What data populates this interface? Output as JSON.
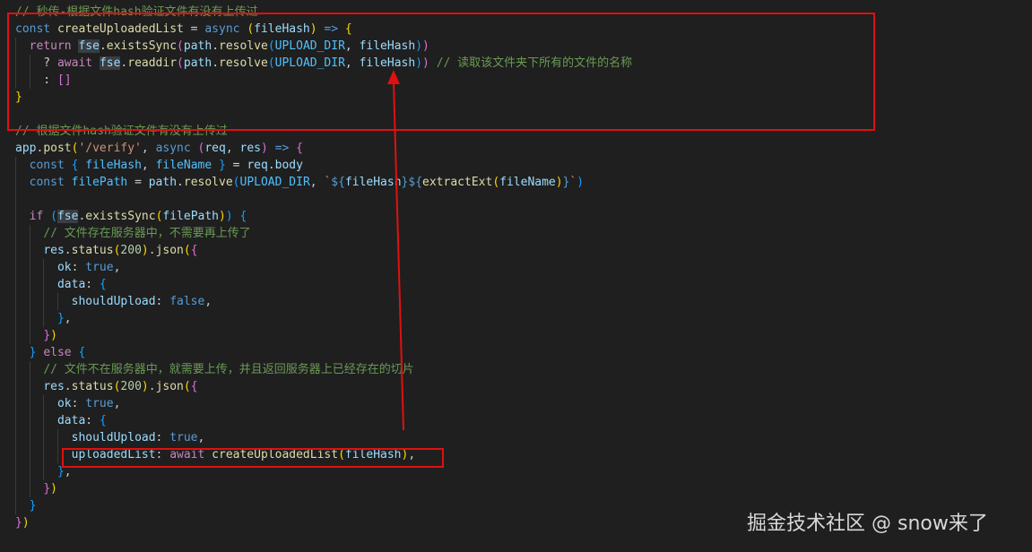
{
  "code": {
    "lines": [
      [
        {
          "t": "// 秒传-根据文件hash验证文件有没有上传过",
          "c": "comment"
        }
      ],
      [
        {
          "t": "const",
          "c": "kw"
        },
        {
          "t": " ",
          "c": "def"
        },
        {
          "t": "createUploadedList",
          "c": "fn"
        },
        {
          "t": " = ",
          "c": "def"
        },
        {
          "t": "async",
          "c": "kw"
        },
        {
          "t": " ",
          "c": "def"
        },
        {
          "t": "(",
          "c": "br1"
        },
        {
          "t": "fileHash",
          "c": "var"
        },
        {
          "t": ")",
          "c": "br1"
        },
        {
          "t": " ",
          "c": "def"
        },
        {
          "t": "=>",
          "c": "kw"
        },
        {
          "t": " ",
          "c": "def"
        },
        {
          "t": "{",
          "c": "br1"
        }
      ],
      [
        {
          "t": "  ",
          "c": "def"
        },
        {
          "t": "return",
          "c": "ctrl"
        },
        {
          "t": " ",
          "c": "def"
        },
        {
          "t": "fse",
          "c": "var",
          "hl": true
        },
        {
          "t": ".",
          "c": "def"
        },
        {
          "t": "existsSync",
          "c": "fn"
        },
        {
          "t": "(",
          "c": "br2"
        },
        {
          "t": "path",
          "c": "var"
        },
        {
          "t": ".",
          "c": "def"
        },
        {
          "t": "resolve",
          "c": "fn"
        },
        {
          "t": "(",
          "c": "br3"
        },
        {
          "t": "UPLOAD_DIR",
          "c": "const"
        },
        {
          "t": ", ",
          "c": "def"
        },
        {
          "t": "fileHash",
          "c": "var"
        },
        {
          "t": ")",
          "c": "br3"
        },
        {
          "t": ")",
          "c": "br2"
        }
      ],
      [
        {
          "t": "    ? ",
          "c": "def"
        },
        {
          "t": "await",
          "c": "ctrl"
        },
        {
          "t": " ",
          "c": "def"
        },
        {
          "t": "fse",
          "c": "var",
          "hl": true
        },
        {
          "t": ".",
          "c": "def"
        },
        {
          "t": "readdir",
          "c": "fn"
        },
        {
          "t": "(",
          "c": "br2"
        },
        {
          "t": "path",
          "c": "var"
        },
        {
          "t": ".",
          "c": "def"
        },
        {
          "t": "resolve",
          "c": "fn"
        },
        {
          "t": "(",
          "c": "br3"
        },
        {
          "t": "UPLOAD_DIR",
          "c": "const"
        },
        {
          "t": ", ",
          "c": "def"
        },
        {
          "t": "fileHash",
          "c": "var"
        },
        {
          "t": ")",
          "c": "br3"
        },
        {
          "t": ")",
          "c": "br2"
        },
        {
          "t": " ",
          "c": "def"
        },
        {
          "t": "// 读取该文件夹下所有的文件的名称",
          "c": "comment"
        }
      ],
      [
        {
          "t": "    : ",
          "c": "def"
        },
        {
          "t": "[]",
          "c": "br2"
        }
      ],
      [
        {
          "t": "}",
          "c": "br1"
        }
      ],
      [],
      [
        {
          "t": "// 根据文件hash验证文件有没有上传过",
          "c": "comment"
        }
      ],
      [
        {
          "t": "app",
          "c": "var"
        },
        {
          "t": ".",
          "c": "def"
        },
        {
          "t": "post",
          "c": "fn"
        },
        {
          "t": "(",
          "c": "br1"
        },
        {
          "t": "'/verify'",
          "c": "str"
        },
        {
          "t": ", ",
          "c": "def"
        },
        {
          "t": "async",
          "c": "kw"
        },
        {
          "t": " ",
          "c": "def"
        },
        {
          "t": "(",
          "c": "br2"
        },
        {
          "t": "req",
          "c": "var"
        },
        {
          "t": ", ",
          "c": "def"
        },
        {
          "t": "res",
          "c": "var"
        },
        {
          "t": ")",
          "c": "br2"
        },
        {
          "t": " ",
          "c": "def"
        },
        {
          "t": "=>",
          "c": "kw"
        },
        {
          "t": " ",
          "c": "def"
        },
        {
          "t": "{",
          "c": "br2"
        }
      ],
      [
        {
          "t": "  ",
          "c": "def"
        },
        {
          "t": "const",
          "c": "kw"
        },
        {
          "t": " ",
          "c": "def"
        },
        {
          "t": "{",
          "c": "br3"
        },
        {
          "t": " ",
          "c": "def"
        },
        {
          "t": "fileHash",
          "c": "const"
        },
        {
          "t": ", ",
          "c": "def"
        },
        {
          "t": "fileName",
          "c": "const"
        },
        {
          "t": " ",
          "c": "def"
        },
        {
          "t": "}",
          "c": "br3"
        },
        {
          "t": " = ",
          "c": "def"
        },
        {
          "t": "req",
          "c": "var"
        },
        {
          "t": ".",
          "c": "def"
        },
        {
          "t": "body",
          "c": "var"
        }
      ],
      [
        {
          "t": "  ",
          "c": "def"
        },
        {
          "t": "const",
          "c": "kw"
        },
        {
          "t": " ",
          "c": "def"
        },
        {
          "t": "filePath",
          "c": "const"
        },
        {
          "t": " = ",
          "c": "def"
        },
        {
          "t": "path",
          "c": "var"
        },
        {
          "t": ".",
          "c": "def"
        },
        {
          "t": "resolve",
          "c": "fn"
        },
        {
          "t": "(",
          "c": "br3"
        },
        {
          "t": "UPLOAD_DIR",
          "c": "const"
        },
        {
          "t": ", ",
          "c": "def"
        },
        {
          "t": "`",
          "c": "str"
        },
        {
          "t": "${",
          "c": "kw"
        },
        {
          "t": "fileHash",
          "c": "var"
        },
        {
          "t": "}",
          "c": "kw"
        },
        {
          "t": "${",
          "c": "kw"
        },
        {
          "t": "extractExt",
          "c": "fn"
        },
        {
          "t": "(",
          "c": "br1"
        },
        {
          "t": "fileName",
          "c": "var"
        },
        {
          "t": ")",
          "c": "br1"
        },
        {
          "t": "}",
          "c": "kw"
        },
        {
          "t": "`",
          "c": "str"
        },
        {
          "t": ")",
          "c": "br3"
        }
      ],
      [],
      [
        {
          "t": "  ",
          "c": "def"
        },
        {
          "t": "if",
          "c": "ctrl"
        },
        {
          "t": " ",
          "c": "def"
        },
        {
          "t": "(",
          "c": "br3"
        },
        {
          "t": "fse",
          "c": "var",
          "hl": true
        },
        {
          "t": ".",
          "c": "def"
        },
        {
          "t": "existsSync",
          "c": "fn"
        },
        {
          "t": "(",
          "c": "br1"
        },
        {
          "t": "filePath",
          "c": "var"
        },
        {
          "t": ")",
          "c": "br1"
        },
        {
          "t": ")",
          "c": "br3"
        },
        {
          "t": " ",
          "c": "def"
        },
        {
          "t": "{",
          "c": "br3"
        }
      ],
      [
        {
          "t": "    ",
          "c": "def"
        },
        {
          "t": "// 文件存在服务器中，不需要再上传了",
          "c": "comment"
        }
      ],
      [
        {
          "t": "    ",
          "c": "def"
        },
        {
          "t": "res",
          "c": "var"
        },
        {
          "t": ".",
          "c": "def"
        },
        {
          "t": "status",
          "c": "fn"
        },
        {
          "t": "(",
          "c": "br1"
        },
        {
          "t": "200",
          "c": "num"
        },
        {
          "t": ")",
          "c": "br1"
        },
        {
          "t": ".",
          "c": "def"
        },
        {
          "t": "json",
          "c": "fn"
        },
        {
          "t": "(",
          "c": "br1"
        },
        {
          "t": "{",
          "c": "br2"
        }
      ],
      [
        {
          "t": "      ",
          "c": "def"
        },
        {
          "t": "ok",
          "c": "var"
        },
        {
          "t": ": ",
          "c": "def"
        },
        {
          "t": "true",
          "c": "kw"
        },
        {
          "t": ",",
          "c": "def"
        }
      ],
      [
        {
          "t": "      ",
          "c": "def"
        },
        {
          "t": "data",
          "c": "var"
        },
        {
          "t": ": ",
          "c": "def"
        },
        {
          "t": "{",
          "c": "br3"
        }
      ],
      [
        {
          "t": "        ",
          "c": "def"
        },
        {
          "t": "shouldUpload",
          "c": "var"
        },
        {
          "t": ": ",
          "c": "def"
        },
        {
          "t": "false",
          "c": "kw"
        },
        {
          "t": ",",
          "c": "def"
        }
      ],
      [
        {
          "t": "      ",
          "c": "def"
        },
        {
          "t": "}",
          "c": "br3"
        },
        {
          "t": ",",
          "c": "def"
        }
      ],
      [
        {
          "t": "    ",
          "c": "def"
        },
        {
          "t": "}",
          "c": "br2"
        },
        {
          "t": ")",
          "c": "br1"
        }
      ],
      [
        {
          "t": "  ",
          "c": "def"
        },
        {
          "t": "}",
          "c": "br3"
        },
        {
          "t": " ",
          "c": "def"
        },
        {
          "t": "else",
          "c": "ctrl"
        },
        {
          "t": " ",
          "c": "def"
        },
        {
          "t": "{",
          "c": "br3"
        }
      ],
      [
        {
          "t": "    ",
          "c": "def"
        },
        {
          "t": "// 文件不在服务器中，就需要上传，并且返回服务器上已经存在的切片",
          "c": "comment"
        }
      ],
      [
        {
          "t": "    ",
          "c": "def"
        },
        {
          "t": "res",
          "c": "var"
        },
        {
          "t": ".",
          "c": "def"
        },
        {
          "t": "status",
          "c": "fn"
        },
        {
          "t": "(",
          "c": "br1"
        },
        {
          "t": "200",
          "c": "num"
        },
        {
          "t": ")",
          "c": "br1"
        },
        {
          "t": ".",
          "c": "def"
        },
        {
          "t": "json",
          "c": "fn"
        },
        {
          "t": "(",
          "c": "br1"
        },
        {
          "t": "{",
          "c": "br2"
        }
      ],
      [
        {
          "t": "      ",
          "c": "def"
        },
        {
          "t": "ok",
          "c": "var"
        },
        {
          "t": ": ",
          "c": "def"
        },
        {
          "t": "true",
          "c": "kw"
        },
        {
          "t": ",",
          "c": "def"
        }
      ],
      [
        {
          "t": "      ",
          "c": "def"
        },
        {
          "t": "data",
          "c": "var"
        },
        {
          "t": ": ",
          "c": "def"
        },
        {
          "t": "{",
          "c": "br3"
        }
      ],
      [
        {
          "t": "        ",
          "c": "def"
        },
        {
          "t": "shouldUpload",
          "c": "var"
        },
        {
          "t": ": ",
          "c": "def"
        },
        {
          "t": "true",
          "c": "kw"
        },
        {
          "t": ",",
          "c": "def"
        }
      ],
      [
        {
          "t": "        ",
          "c": "def"
        },
        {
          "t": "uploadedList",
          "c": "var"
        },
        {
          "t": ": ",
          "c": "def"
        },
        {
          "t": "await",
          "c": "ctrl"
        },
        {
          "t": " ",
          "c": "def"
        },
        {
          "t": "createUploadedList",
          "c": "fn"
        },
        {
          "t": "(",
          "c": "br1"
        },
        {
          "t": "fileHash",
          "c": "var"
        },
        {
          "t": ")",
          "c": "br1"
        },
        {
          "t": ",",
          "c": "def"
        }
      ],
      [
        {
          "t": "      ",
          "c": "def"
        },
        {
          "t": "}",
          "c": "br3"
        },
        {
          "t": ",",
          "c": "def"
        }
      ],
      [
        {
          "t": "    ",
          "c": "def"
        },
        {
          "t": "}",
          "c": "br2"
        },
        {
          "t": ")",
          "c": "br1"
        }
      ],
      [
        {
          "t": "  ",
          "c": "def"
        },
        {
          "t": "}",
          "c": "br3"
        }
      ],
      [
        {
          "t": "}",
          "c": "br2"
        },
        {
          "t": ")",
          "c": "br1"
        }
      ]
    ]
  },
  "annotations": {
    "highlight_color": "#e01010",
    "boxes": [
      "createUploadedList-definition-box",
      "uploadedList-call-box"
    ],
    "arrow": "call-to-definition-arrow"
  },
  "watermark": {
    "text": "掘金技术社区 @ snow来了"
  }
}
